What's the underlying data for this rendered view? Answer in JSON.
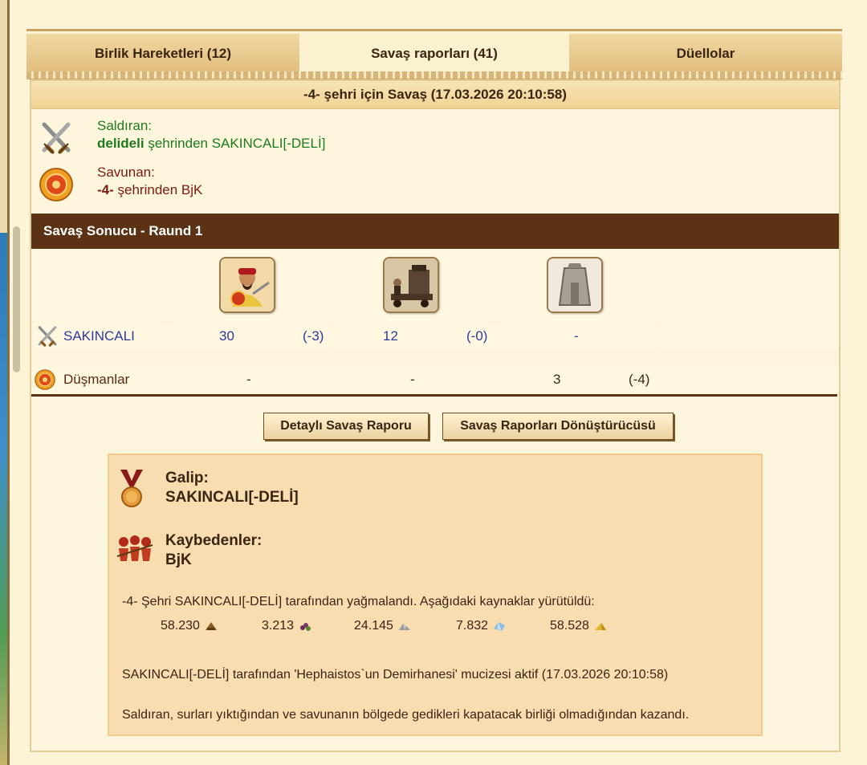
{
  "tabs": [
    {
      "label": "Birlik Hareketleri (12)",
      "active": false
    },
    {
      "label": "Savaş raporları (41)",
      "active": true
    },
    {
      "label": "Düellolar",
      "active": false
    }
  ],
  "report": {
    "title": "-4- şehri için Savaş (17.03.2026 20:10:58)",
    "attacker": {
      "role": "Saldıran:",
      "city": "delideli",
      "suffix": "şehrinden SAKINCALI[-DELİ]"
    },
    "defender": {
      "role": "Savunan:",
      "city": "-4-",
      "suffix": "şehrinden BjK"
    },
    "result_header": "Savaş Sonucu - Raund 1",
    "units": [
      "sword-warrior",
      "catapult",
      "city-wall"
    ],
    "rows": [
      {
        "label": "SAKINCALI",
        "cells": [
          {
            "count": "30",
            "loss": "(-3)"
          },
          {
            "count": "12",
            "loss": "(-0)"
          },
          {
            "count": "-",
            "loss": ""
          }
        ]
      },
      {
        "label": "Düşmanlar",
        "cells": [
          {
            "count": "-",
            "loss": ""
          },
          {
            "count": "-",
            "loss": ""
          },
          {
            "count": "3",
            "loss": "(-4)"
          }
        ]
      }
    ],
    "buttons": {
      "detail": "Detaylı Savaş Raporu",
      "converter": "Savaş Raporları Dönüştürücüsü"
    },
    "outcome": {
      "winner_title": "Galip:",
      "winner_name": "SAKINCALI[-DELİ]",
      "loser_title": "Kaybedenler:",
      "loser_name": "BjK",
      "loot_text": "-4- Şehri SAKINCALI[-DELİ] tarafından yağmalandı. Aşağıdaki kaynaklar yürütüldü:",
      "resources": [
        {
          "amount": "58.230",
          "icon": "wood-icon"
        },
        {
          "amount": "3.213",
          "icon": "wine-icon"
        },
        {
          "amount": "24.145",
          "icon": "marble-icon"
        },
        {
          "amount": "7.832",
          "icon": "crystal-icon"
        },
        {
          "amount": "58.528",
          "icon": "sulfur-icon"
        }
      ],
      "wonder_text": "SAKINCALI[-DELİ] tarafından 'Hephaistos`un Demirhanesi' mucizesi aktif (17.03.2026 20:10:58)",
      "reason_text": "Saldıran, surları yıktığından ve savunanın bölgede gedikleri kapatacak birliği olmadığından kazandı."
    }
  },
  "colors": {
    "attacker": "#1f7a1f",
    "defender": "#7a1a10",
    "header_bar": "#5b3214",
    "unit_text": "#2b3a9c"
  }
}
